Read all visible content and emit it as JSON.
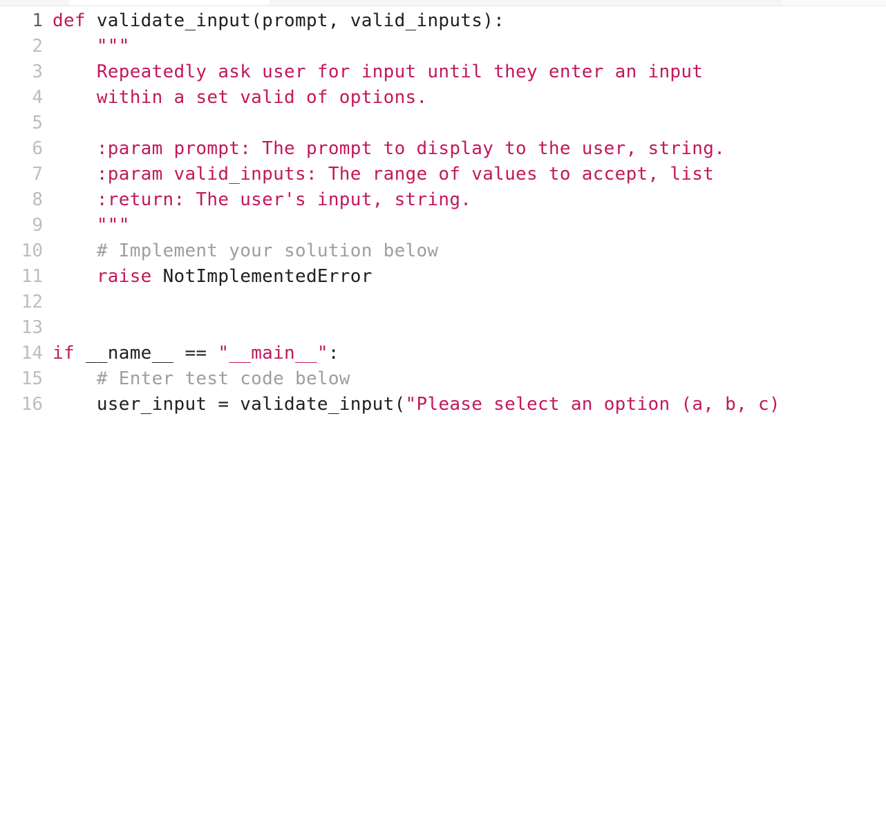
{
  "colors": {
    "keyword": "#c2185b",
    "docstring": "#c2185b",
    "comment": "#9e9e9e",
    "plain": "#202020",
    "gutter": "#bdbdbd",
    "gutter_current": "#606060"
  },
  "editor": {
    "current_line": 1,
    "total_lines": 16
  },
  "lines": {
    "1": {
      "kw1": "def ",
      "fn": "validate_input",
      "rest": "(prompt, valid_inputs):"
    },
    "2": {
      "indent": "    ",
      "doc": "\"\"\""
    },
    "3": {
      "indent": "    ",
      "doc": "Repeatedly ask user for input until they enter an input"
    },
    "4": {
      "indent": "    ",
      "doc": "within a set valid of options."
    },
    "5": {
      "indent": "    ",
      "doc": ""
    },
    "6": {
      "indent": "    ",
      "doc": ":param prompt: The prompt to display to the user, string."
    },
    "7": {
      "indent": "    ",
      "doc": ":param valid_inputs: The range of values to accept, list"
    },
    "8": {
      "indent": "    ",
      "doc": ":return: The user's input, string."
    },
    "9": {
      "indent": "    ",
      "doc": "\"\"\""
    },
    "10": {
      "indent": "    ",
      "cmt": "# Implement your solution below"
    },
    "11": {
      "indent": "    ",
      "kw": "raise ",
      "rest": "NotImplementedError"
    },
    "12": {
      "blank": ""
    },
    "13": {
      "blank": ""
    },
    "14": {
      "kw": "if ",
      "a": "__name__ == ",
      "str": "\"__main__\"",
      "b": ":"
    },
    "15": {
      "indent": "    ",
      "cmt": "# Enter test code below"
    },
    "16": {
      "indent": "    ",
      "a": "user_input = validate_input(",
      "str": "\"Please select an option (a, b, c)"
    }
  },
  "gutter": {
    "1": "1",
    "2": "2",
    "3": "3",
    "4": "4",
    "5": "5",
    "6": "6",
    "7": "7",
    "8": "8",
    "9": "9",
    "10": "10",
    "11": "11",
    "12": "12",
    "13": "13",
    "14": "14",
    "15": "15",
    "16": "16"
  }
}
